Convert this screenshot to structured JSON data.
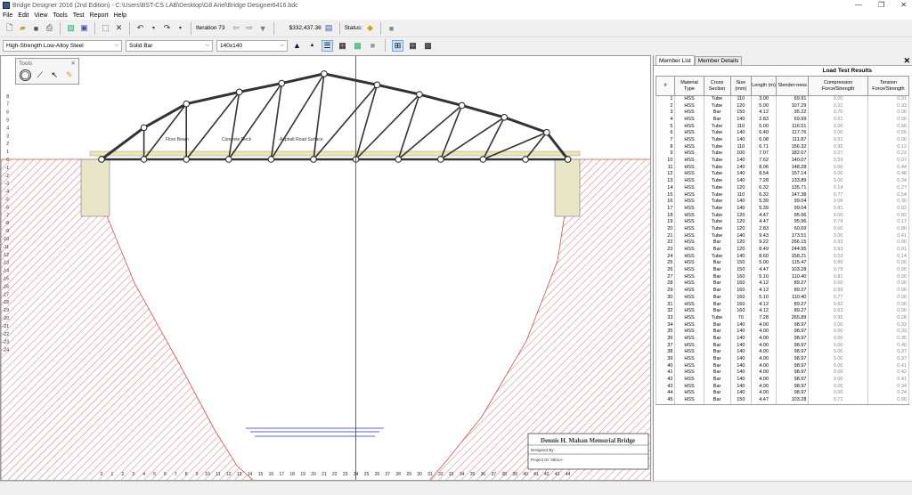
{
  "window": {
    "title": "Bridge Designer 2016 (2nd Edition) - C:\\Users\\BST-CS LAB\\Desktop\\G8 Ariel\\Bridge Designer6416.bdc",
    "min_glyph": "—",
    "max_glyph": "❐",
    "close_glyph": "✕"
  },
  "menu": [
    "File",
    "Edit",
    "View",
    "Tools",
    "Test",
    "Report",
    "Help"
  ],
  "toolbar": {
    "iteration_label": "Iteration 73",
    "cost": "$332,437.36",
    "status_label": "Status:"
  },
  "selectors": {
    "material": "High-Strength Low-Alloy Steel",
    "section": "Solid Bar",
    "size": "140x140"
  },
  "tools_palette": {
    "title": "Tools",
    "close_glyph": "✕"
  },
  "drawing": {
    "labels": {
      "floor_beam": "Floor Beam",
      "concrete_deck": "Concrete Deck",
      "asphalt": "Asphalt Road Surface"
    },
    "x_ticks": [
      "0",
      "1",
      "2",
      "3",
      "4",
      "5",
      "6",
      "7",
      "8",
      "9",
      "10",
      "11",
      "12",
      "13",
      "14",
      "15",
      "16",
      "17",
      "18",
      "19",
      "20",
      "21",
      "22",
      "23",
      "24",
      "25",
      "26",
      "27",
      "28",
      "29",
      "30",
      "31",
      "32",
      "33",
      "34",
      "35",
      "36",
      "37",
      "38",
      "39",
      "40",
      "41",
      "42",
      "43",
      "44"
    ],
    "y_ticks": [
      "8",
      "7",
      "6",
      "5",
      "4",
      "3",
      "2",
      "1",
      "0",
      "-1",
      "-2",
      "-3",
      "-4",
      "-5",
      "-6",
      "-7",
      "-8",
      "-9",
      "-10",
      "-11",
      "-12",
      "-13",
      "-14",
      "-15",
      "-16",
      "-17",
      "-18",
      "-19",
      "-20",
      "-21",
      "-22",
      "-23",
      "-24"
    ],
    "title_block": {
      "bridge_name": "Dennis H. Mahan Memorial Bridge",
      "designed_by": "Designed By:",
      "project_id": "Project ID: 0001A-"
    }
  },
  "panel": {
    "tabs": [
      "Member List",
      "Member Details"
    ],
    "close_glyph": "✕",
    "title": "Load Test Results",
    "headers": [
      "#",
      "Material Type",
      "Cross Section",
      "Size (mm)",
      "Length (m)",
      "Slender-ness",
      "Compression Force/Strength",
      "Tension Force/Strength"
    ],
    "rows": [
      [
        "1",
        "HSS",
        "Tube",
        "110",
        "3.00",
        "69.91",
        "0.00",
        "0.91"
      ],
      [
        "2",
        "HSS",
        "Tube",
        "120",
        "5.00",
        "107.29",
        "0.31",
        "0.33"
      ],
      [
        "3",
        "HSS",
        "Bar",
        "150",
        "4.12",
        "95.22",
        "0.70",
        "0.00"
      ],
      [
        "4",
        "HSS",
        "Bar",
        "140",
        "2.83",
        "69.99",
        "0.51",
        "0.00"
      ],
      [
        "5",
        "HSS",
        "Tube",
        "110",
        "5.00",
        "116.51",
        "0.00",
        "0.66"
      ],
      [
        "6",
        "HSS",
        "Tube",
        "140",
        "6.40",
        "117.76",
        "0.00",
        "0.55"
      ],
      [
        "7",
        "HSS",
        "Tube",
        "140",
        "6.08",
        "111.87",
        "0.51",
        "0.00"
      ],
      [
        "8",
        "HSS",
        "Tube",
        "110",
        "6.71",
        "156.32",
        "0.95",
        "0.12"
      ],
      [
        "9",
        "HSS",
        "Tube",
        "100",
        "7.07",
        "182.07",
        "0.27",
        "0.22"
      ],
      [
        "10",
        "HSS",
        "Tube",
        "140",
        "7.62",
        "140.07",
        "0.59",
        "0.07"
      ],
      [
        "11",
        "HSS",
        "Tube",
        "140",
        "8.06",
        "148.28",
        "0.00",
        "0.44"
      ],
      [
        "12",
        "HSS",
        "Tube",
        "140",
        "8.54",
        "157.14",
        "0.00",
        "0.48"
      ],
      [
        "13",
        "HSS",
        "Tube",
        "140",
        "7.28",
        "133.89",
        "0.00",
        "0.34"
      ],
      [
        "14",
        "HSS",
        "Tube",
        "120",
        "6.32",
        "135.71",
        "0.14",
        "0.27"
      ],
      [
        "15",
        "HSS",
        "Tube",
        "110",
        "6.32",
        "147.38",
        "0.77",
        "0.54"
      ],
      [
        "16",
        "HSS",
        "Tube",
        "140",
        "5.39",
        "99.04",
        "0.06",
        "0.30"
      ],
      [
        "17",
        "HSS",
        "Tube",
        "140",
        "5.39",
        "99.04",
        "0.81",
        "0.02"
      ],
      [
        "18",
        "HSS",
        "Tube",
        "120",
        "4.47",
        "95.96",
        "0.00",
        "0.82"
      ],
      [
        "19",
        "HSS",
        "Tube",
        "120",
        "4.47",
        "95.96",
        "0.74",
        "0.17"
      ],
      [
        "20",
        "HSS",
        "Tube",
        "120",
        "2.83",
        "60.69",
        "0.00",
        "0.80"
      ],
      [
        "21",
        "HSS",
        "Tube",
        "140",
        "9.43",
        "173.51",
        "0.00",
        "0.41"
      ],
      [
        "22",
        "HSS",
        "Bar",
        "120",
        "9.22",
        "266.15",
        "0.93",
        "0.00"
      ],
      [
        "23",
        "HSS",
        "Bar",
        "120",
        "8.49",
        "244.95",
        "0.93",
        "0.01"
      ],
      [
        "24",
        "HSS",
        "Tube",
        "140",
        "8.60",
        "158.21",
        "0.53",
        "0.14"
      ],
      [
        "25",
        "HSS",
        "Bar",
        "150",
        "5.00",
        "115.47",
        "0.89",
        "0.00"
      ],
      [
        "26",
        "HSS",
        "Bar",
        "150",
        "4.47",
        "103.28",
        "0.79",
        "0.00"
      ],
      [
        "27",
        "HSS",
        "Bar",
        "160",
        "5.10",
        "110.40",
        "0.81",
        "0.00"
      ],
      [
        "28",
        "HSS",
        "Bar",
        "160",
        "4.12",
        "89.27",
        "0.60",
        "0.00"
      ],
      [
        "29",
        "HSS",
        "Bar",
        "160",
        "4.12",
        "89.27",
        "0.59",
        "0.00"
      ],
      [
        "30",
        "HSS",
        "Bar",
        "160",
        "5.10",
        "110.40",
        "0.77",
        "0.00"
      ],
      [
        "31",
        "HSS",
        "Bar",
        "160",
        "4.12",
        "89.27",
        "0.62",
        "0.00"
      ],
      [
        "32",
        "HSS",
        "Bar",
        "160",
        "4.12",
        "89.27",
        "0.63",
        "0.00"
      ],
      [
        "33",
        "HSS",
        "Tube",
        "70",
        "7.28",
        "265.89",
        "0.95",
        "0.28"
      ],
      [
        "34",
        "HSS",
        "Bar",
        "140",
        "4.00",
        "98.97",
        "0.00",
        "0.33"
      ],
      [
        "35",
        "HSS",
        "Bar",
        "140",
        "4.00",
        "98.97",
        "0.00",
        "0.33"
      ],
      [
        "36",
        "HSS",
        "Bar",
        "140",
        "4.00",
        "98.97",
        "0.00",
        "0.35"
      ],
      [
        "37",
        "HSS",
        "Bar",
        "140",
        "4.00",
        "98.97",
        "0.00",
        "0.40"
      ],
      [
        "38",
        "HSS",
        "Bar",
        "140",
        "4.00",
        "98.97",
        "0.00",
        "0.37"
      ],
      [
        "39",
        "HSS",
        "Bar",
        "140",
        "4.00",
        "98.97",
        "0.00",
        "0.37"
      ],
      [
        "40",
        "HSS",
        "Bar",
        "140",
        "4.00",
        "98.97",
        "0.00",
        "0.41"
      ],
      [
        "41",
        "HSS",
        "Bar",
        "140",
        "4.00",
        "98.97",
        "0.00",
        "0.42"
      ],
      [
        "42",
        "HSS",
        "Bar",
        "140",
        "4.00",
        "98.97",
        "0.00",
        "0.41"
      ],
      [
        "43",
        "HSS",
        "Bar",
        "140",
        "4.00",
        "98.97",
        "0.00",
        "0.34"
      ],
      [
        "44",
        "HSS",
        "Bar",
        "140",
        "4.00",
        "98.97",
        "0.00",
        "0.24"
      ],
      [
        "45",
        "HSS",
        "Bar",
        "150",
        "4.47",
        "103.28",
        "0.71",
        "0.00"
      ]
    ]
  },
  "colors": {
    "member": "#333333",
    "joint": "#ffffff",
    "hatch": "#d05050",
    "guide": "#2b2bcc",
    "deck": "#e8e8b0"
  }
}
